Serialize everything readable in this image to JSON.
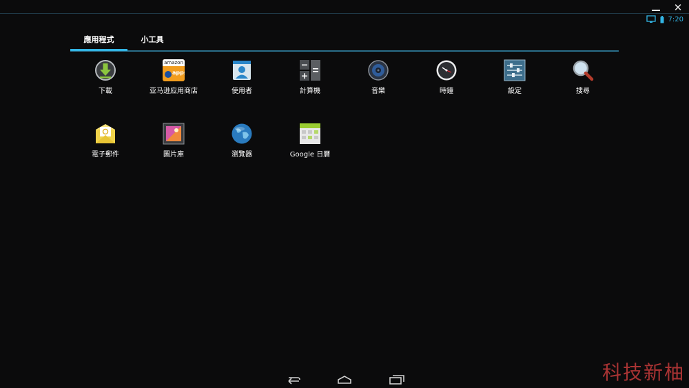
{
  "window_controls": {
    "minimize_icon": "minimize-icon",
    "close_label": "✕"
  },
  "status_bar": {
    "time": "7:20",
    "icons": [
      "screen-icon",
      "battery-icon"
    ],
    "accent": "#33b5e5"
  },
  "tabs": [
    {
      "label": "應用程式",
      "selected": true
    },
    {
      "label": "小工具",
      "selected": false
    }
  ],
  "apps": [
    {
      "label": "下載",
      "icon": "download-icon"
    },
    {
      "label": "亚马逊应用商店",
      "icon": "amazon-appstore-icon",
      "icon_text": "amazon",
      "icon_subtext": "apps"
    },
    {
      "label": "使用者",
      "icon": "contacts-icon"
    },
    {
      "label": "計算機",
      "icon": "calculator-icon"
    },
    {
      "label": "音樂",
      "icon": "music-icon"
    },
    {
      "label": "時鐘",
      "icon": "clock-icon"
    },
    {
      "label": "設定",
      "icon": "settings-icon"
    },
    {
      "label": "搜尋",
      "icon": "search-icon"
    },
    {
      "label": "電子郵件",
      "icon": "email-icon"
    },
    {
      "label": "圖片庫",
      "icon": "gallery-icon"
    },
    {
      "label": "瀏覽器",
      "icon": "browser-icon"
    },
    {
      "label": "Google 日曆",
      "icon": "calendar-icon"
    }
  ],
  "navigation": {
    "icons": [
      "back-icon",
      "home-icon",
      "recent-apps-icon"
    ]
  },
  "watermark": "科技新柚"
}
